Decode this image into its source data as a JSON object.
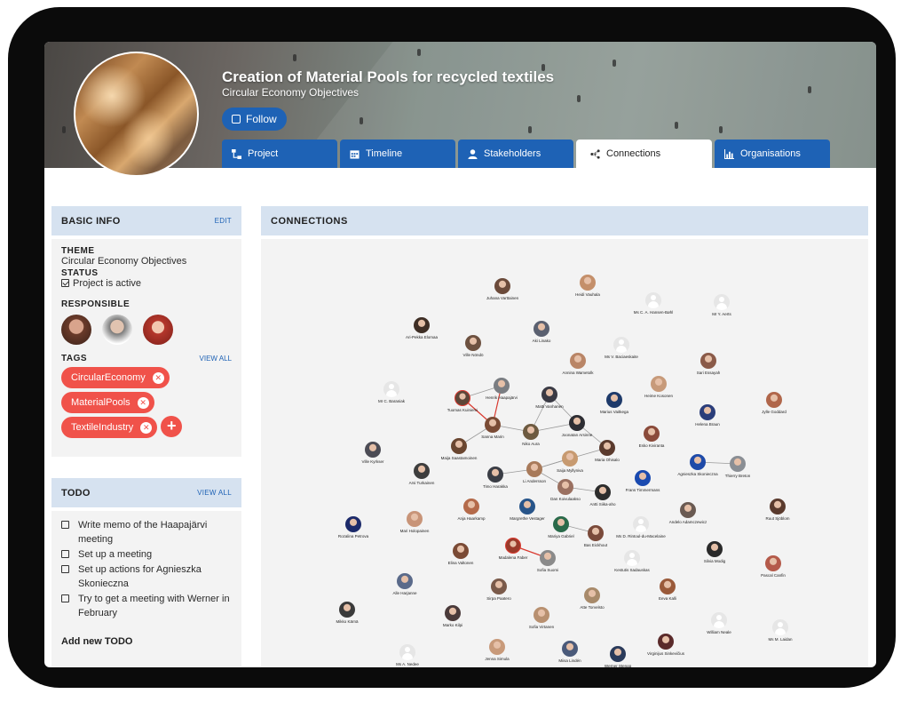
{
  "header": {
    "title": "Creation of Material Pools for recycled textiles",
    "subtitle": "Circular Economy Objectives",
    "follow_label": "Follow"
  },
  "tabs": [
    {
      "label": "Project",
      "icon": "sitemap-icon",
      "active": false
    },
    {
      "label": "Timeline",
      "icon": "calendar-icon",
      "active": false
    },
    {
      "label": "Stakeholders",
      "icon": "user-icon",
      "active": false
    },
    {
      "label": "Connections",
      "icon": "network-icon",
      "active": true
    },
    {
      "label": "Organisations",
      "icon": "bar-chart-icon",
      "active": false
    }
  ],
  "basic_info": {
    "heading": "BASIC INFO",
    "edit_label": "EDIT",
    "theme_label": "THEME",
    "theme_value": "Circular Economy Objectives",
    "status_label": "STATUS",
    "status_value": "Project is active",
    "responsible_label": "RESPONSIBLE",
    "tags_label": "TAGS",
    "tags_view_all": "VIEW ALL",
    "tags": [
      "CircularEconomy",
      "MaterialPools",
      "TextileIndustry"
    ]
  },
  "todo": {
    "heading": "TODO",
    "view_all": "VIEW ALL",
    "items": [
      "Write memo of the Haapajärvi meeting",
      "Set up a meeting",
      "Set up actions for Agnieszka Skonieczna",
      "Try to get a meeting with Werner in February"
    ],
    "add_label": "Add new TODO"
  },
  "connections": {
    "heading": "CONNECTIONS",
    "nodes": [
      {
        "name": "Juhana Varttainen"
      },
      {
        "name": "Heidi Vauhala"
      },
      {
        "name": "Ms C. A. Hansen-Bøhl"
      },
      {
        "name": "Mr Y. Aerts"
      },
      {
        "name": "Ari-Pekka Elomaa"
      },
      {
        "name": "Aki Linako"
      },
      {
        "name": "Ville Nöndö"
      },
      {
        "name": "Ms V. Baciaeskaite"
      },
      {
        "name": "Annina Wametolk"
      },
      {
        "name": "Sari Essayah"
      },
      {
        "name": "Mr C. Baraniak"
      },
      {
        "name": "Henrik Haapajärvi"
      },
      {
        "name": "Tuomas Kuiniemi"
      },
      {
        "name": "Matti Vanhanen"
      },
      {
        "name": "Marius Vaitkega"
      },
      {
        "name": "Heime Kosonen"
      },
      {
        "name": "Jylle Goddard"
      },
      {
        "name": "Helena Braun"
      },
      {
        "name": "Sanna Marin"
      },
      {
        "name": "Niko Aura"
      },
      {
        "name": "Joonatan Arsinne"
      },
      {
        "name": "Esko Kiviranta"
      },
      {
        "name": "Maija Saastamoinen"
      },
      {
        "name": "Maria Ohisalo"
      },
      {
        "name": "Ville Kyrkser"
      },
      {
        "name": "Saija Myllyniva"
      },
      {
        "name": "Agnieszka Skonieczna"
      },
      {
        "name": "Thierry Breton"
      },
      {
        "name": "Arsi Turkainen"
      },
      {
        "name": "Timo Harakka"
      },
      {
        "name": "Li Andersson"
      },
      {
        "name": "Dan Koivulaakso"
      },
      {
        "name": "Frans Timmermans"
      },
      {
        "name": "Antti Siika-aho"
      },
      {
        "name": "Anja Haarkamp"
      },
      {
        "name": "Margrethe Vestager"
      },
      {
        "name": "Andelo Adamczewicz"
      },
      {
        "name": "Ruut Sjöblom"
      },
      {
        "name": "Rozalina Petrova"
      },
      {
        "name": "Mari Holopainen"
      },
      {
        "name": "Mariya Gabriel"
      },
      {
        "name": "Ms D. Rintoul-du-Macelaine"
      },
      {
        "name": "Bas Eickhout"
      },
      {
        "name": "Madalena Faber"
      },
      {
        "name": "Elina Valtonen"
      },
      {
        "name": "Sofia Suomi"
      },
      {
        "name": "Kestutis Sadauskas"
      },
      {
        "name": "Silvia Modig"
      },
      {
        "name": "Pascal Canfin"
      },
      {
        "name": "Alle Harjanne"
      },
      {
        "name": "Sirpa Paatero"
      },
      {
        "name": "Atte Torvelsto"
      },
      {
        "name": "Eeva Kalli"
      },
      {
        "name": "Mikko Kärnä"
      },
      {
        "name": "Marko Kilpi"
      },
      {
        "name": "Sofia Virtanen"
      },
      {
        "name": "William Neale"
      },
      {
        "name": "Ms M. Laidan"
      },
      {
        "name": "Ms A. Nedee"
      },
      {
        "name": "Jenna Simula"
      },
      {
        "name": "Miisa Lindén"
      },
      {
        "name": "Werner Stengg"
      },
      {
        "name": "Virginijus Sinkevičius"
      }
    ]
  }
}
